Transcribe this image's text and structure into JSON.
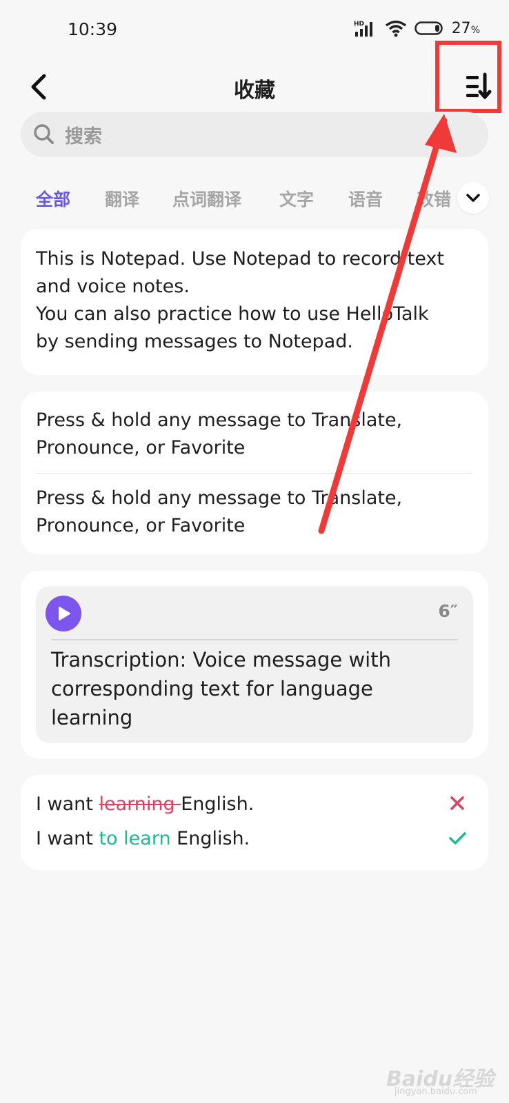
{
  "status_bar": {
    "time": "10:39",
    "battery": "27",
    "battery_unit": "%",
    "network_badge": "HD"
  },
  "nav": {
    "title": "收藏",
    "back_icon": "chevron-left-icon",
    "sort_icon": "sort-descending-icon"
  },
  "search": {
    "placeholder": "搜索",
    "icon": "search-icon"
  },
  "tabs": [
    {
      "label": "全部",
      "active": true
    },
    {
      "label": "翻译"
    },
    {
      "label": "点词翻译"
    },
    {
      "label": "文字"
    },
    {
      "label": "语音"
    },
    {
      "label": "改错"
    }
  ],
  "cards": {
    "notepad": {
      "line1": "This is Notepad. Use Notepad to record text",
      "line2": "and voice notes.",
      "line3": "You can also practice how to use HelloTalk",
      "line4": "by sending messages to Notepad."
    },
    "translate": {
      "item1_line1": "Press & hold any message to Translate,",
      "item1_line2": "Pronounce, or Favorite",
      "item2_line1": "Press & hold any message to Translate,",
      "item2_line2": "Pronounce, or Favorite"
    },
    "voice": {
      "duration": "6″",
      "transcription_line1": "Transcription: Voice message with",
      "transcription_line2": "corresponding text for language",
      "transcription_line3": "learning"
    },
    "correction": {
      "wrong_prefix": "I want ",
      "wrong_word": "learning ",
      "wrong_suffix": "English.",
      "right_prefix": "I want ",
      "right_word": "to learn",
      "right_suffix": " English."
    }
  },
  "watermark": {
    "text": "Baidu经验",
    "sub": "jingyan.baidu.com"
  },
  "colors": {
    "accent": "#6a57e6",
    "play": "#7b55ec",
    "error": "#d84362",
    "success": "#1bbb8f",
    "annotation": "#ef3a37"
  }
}
